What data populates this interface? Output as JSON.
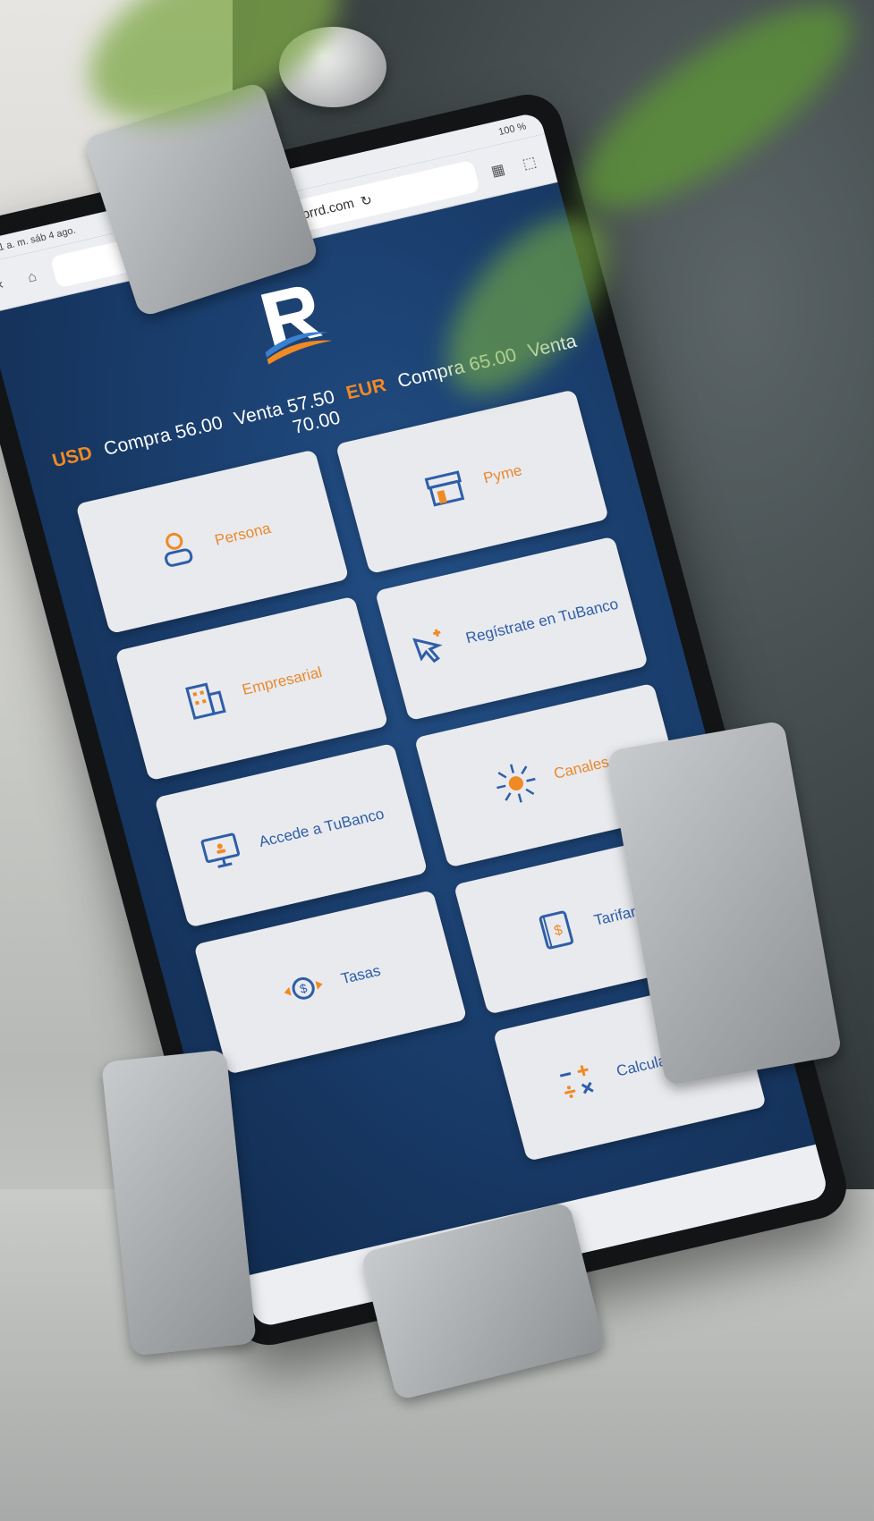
{
  "browser": {
    "status_left": "9:01 a. m.  sáb 4 ago.",
    "status_right": "100 %",
    "url": "intranetweb.reservas.brrd.com",
    "reload_label": "↻"
  },
  "rates": {
    "usd_code": "USD",
    "usd_buy": "Compra 56.00",
    "usd_sell": "Venta 57.50",
    "eur_code": "EUR",
    "eur_buy": "Compra 65.00",
    "eur_sell": "Venta 70.00"
  },
  "menu": {
    "persona": "Persona",
    "pyme": "Pyme",
    "empresarial": "Empresarial",
    "registrate": "Regístrate en TuBanco",
    "accede": "Accede a TuBanco",
    "canales": "Canales",
    "tasas": "Tasas",
    "tarifario": "Tarifario",
    "calculadoras": "Calculadoras"
  },
  "colors": {
    "brand_blue": "#1a3e6d",
    "accent_orange": "#f08a24",
    "card_bg": "#e9eaee"
  }
}
